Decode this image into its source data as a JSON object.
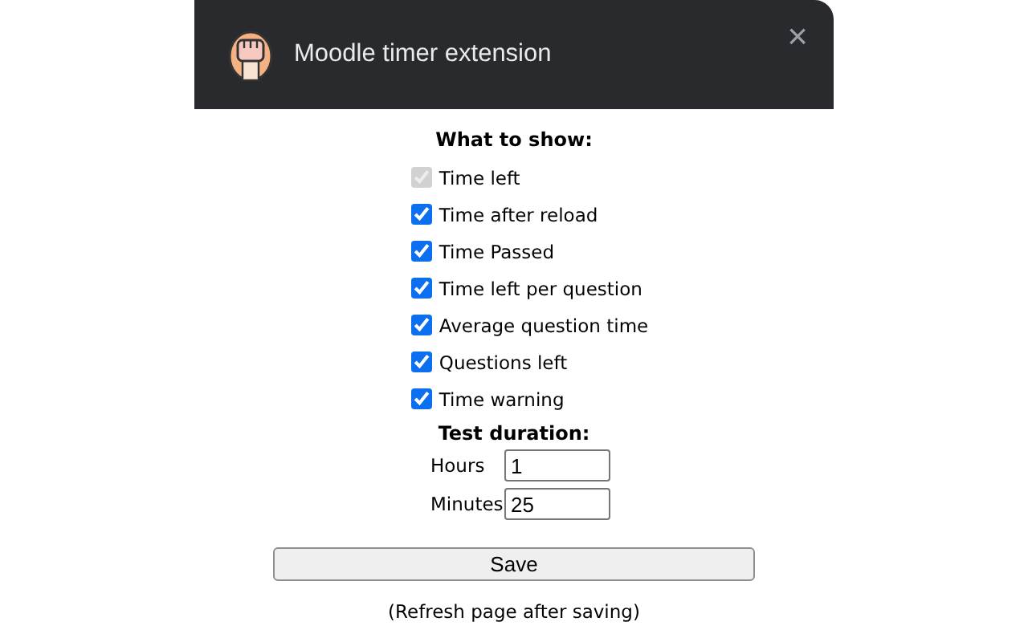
{
  "window": {
    "title": "Moodle timer extension",
    "close": "×"
  },
  "show_heading": "What to show:",
  "options": [
    {
      "label": "Time left",
      "checked": true,
      "disabled": true
    },
    {
      "label": "Time after reload",
      "checked": true,
      "disabled": false
    },
    {
      "label": "Time Passed",
      "checked": true,
      "disabled": false
    },
    {
      "label": "Time left per question",
      "checked": true,
      "disabled": false
    },
    {
      "label": "Average question time",
      "checked": true,
      "disabled": false
    },
    {
      "label": "Questions left",
      "checked": true,
      "disabled": false
    },
    {
      "label": "Time warning",
      "checked": true,
      "disabled": false
    }
  ],
  "duration_heading": "Test duration:",
  "fields": [
    {
      "label": "Hours",
      "value": "1"
    },
    {
      "label": "Minutes",
      "value": "25"
    }
  ],
  "save_button": "Save",
  "note": "(Refresh page after saving)"
}
